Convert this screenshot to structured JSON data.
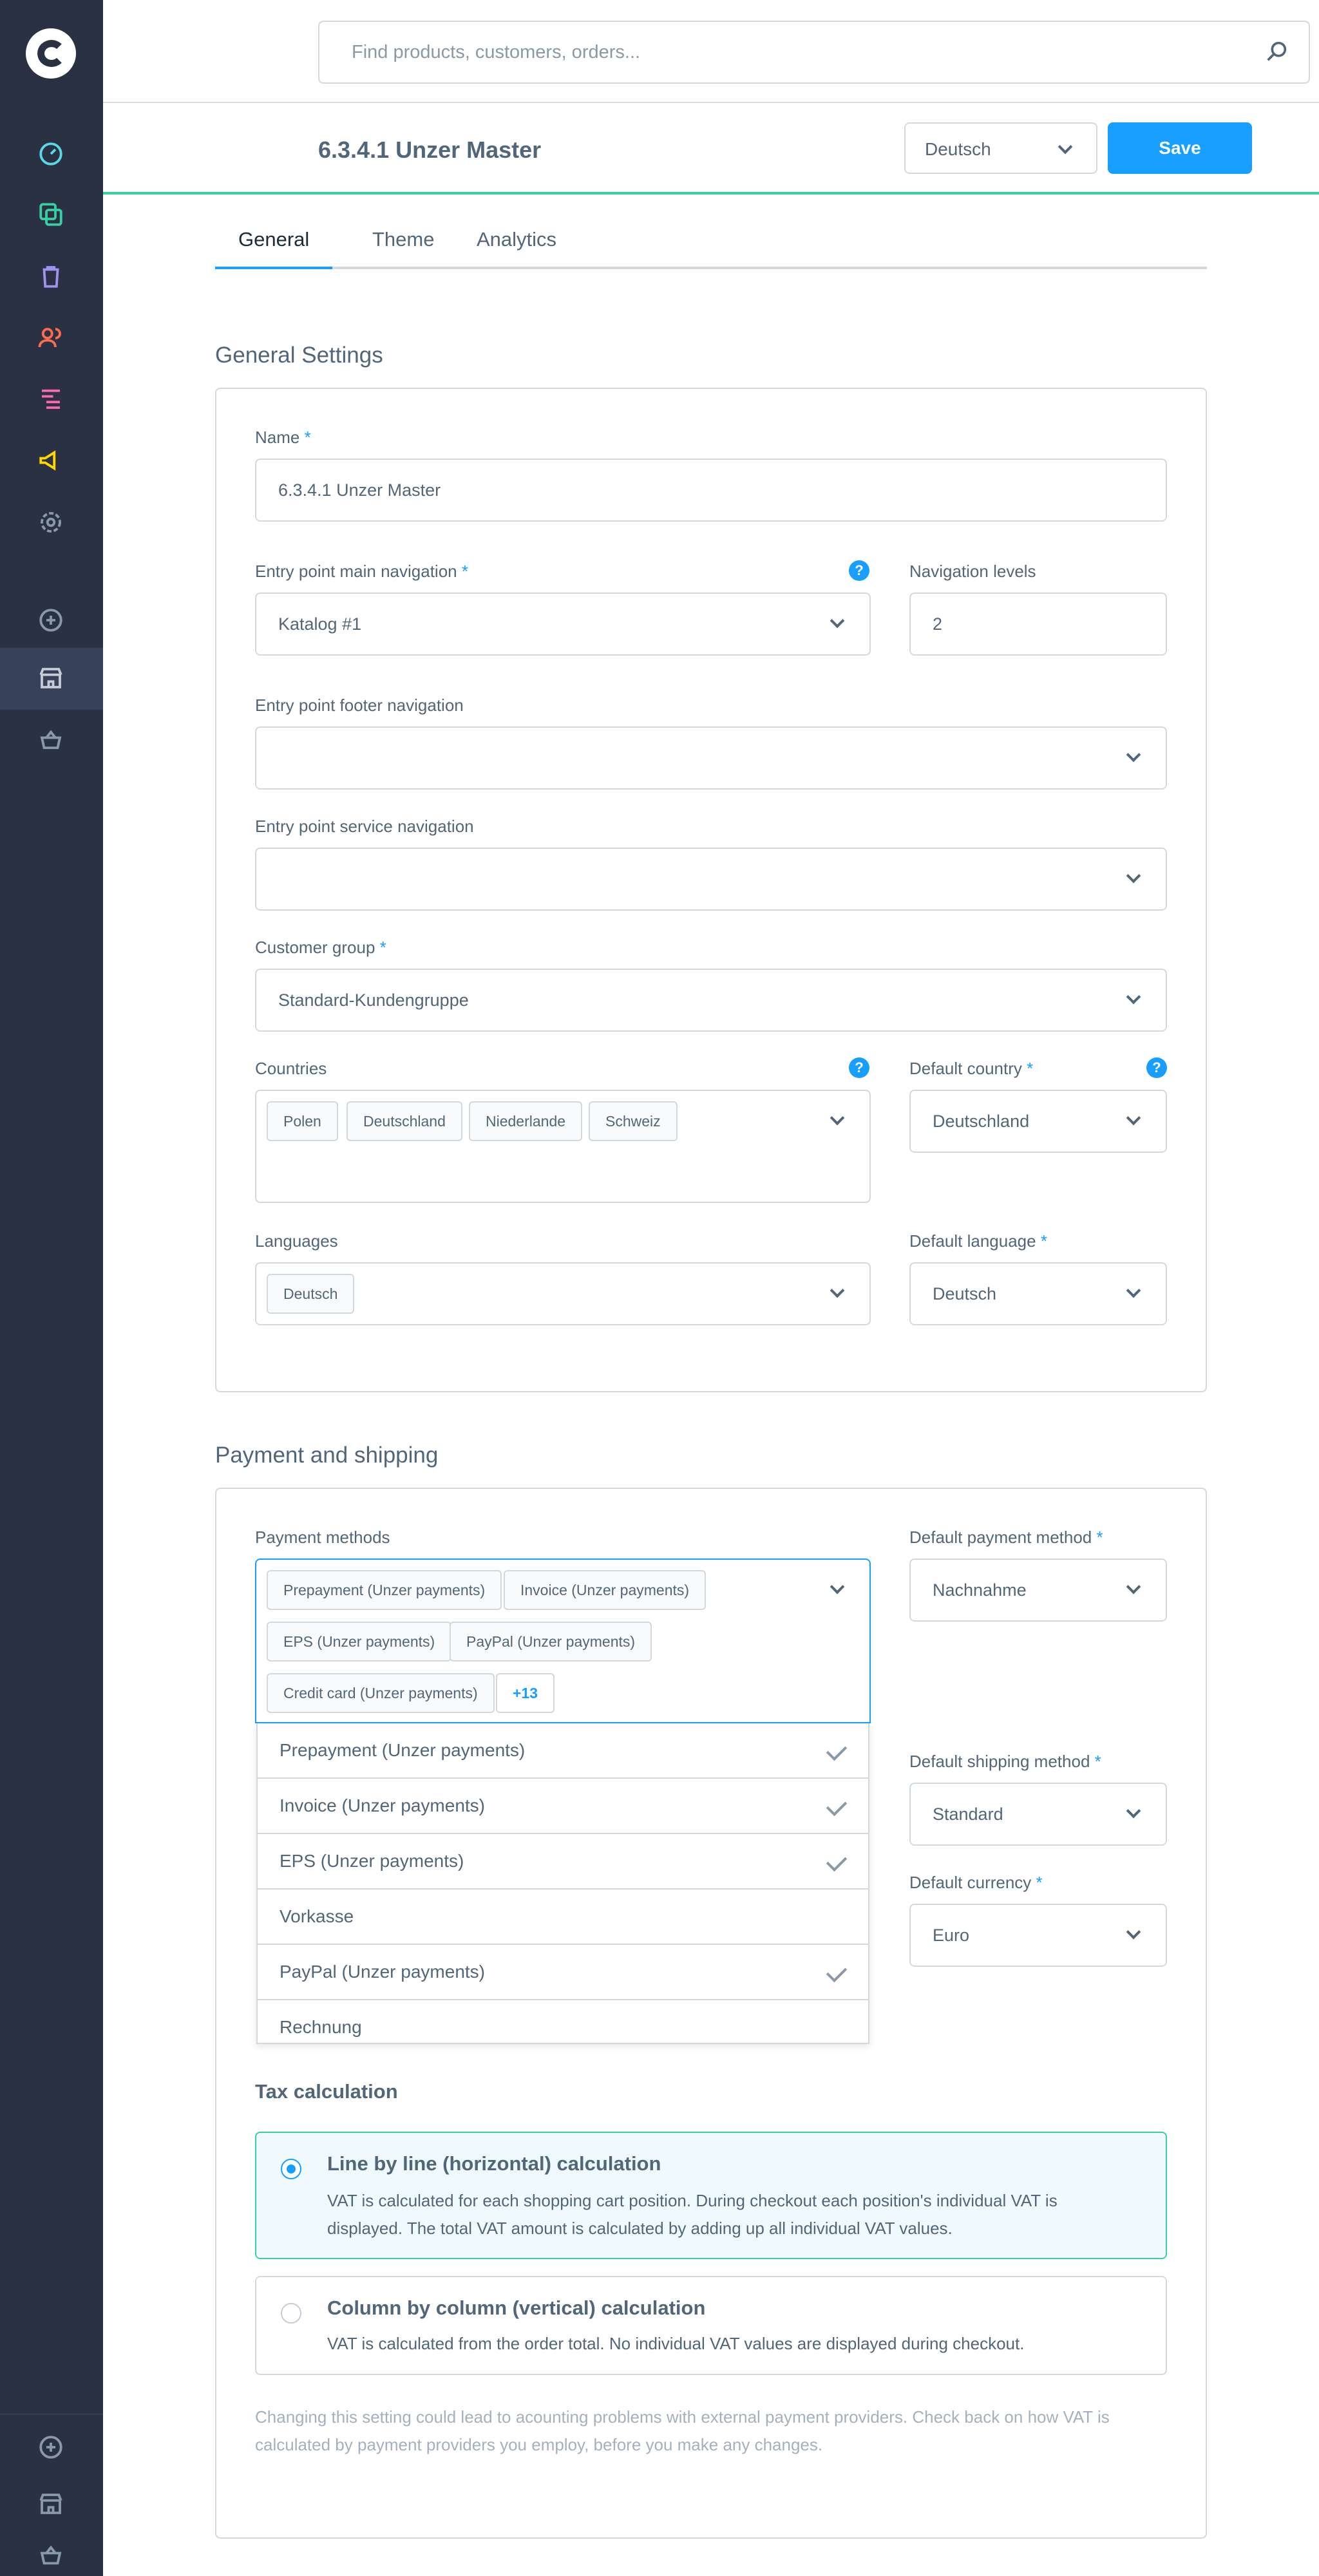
{
  "search": {
    "placeholder": "Find products, customers, orders..."
  },
  "header": {
    "title": "6.3.4.1 Unzer Master",
    "language": "Deutsch",
    "save_label": "Save"
  },
  "tabs": [
    "General",
    "Theme",
    "Analytics"
  ],
  "general": {
    "section_title": "General Settings",
    "name_label": "Name",
    "name_value": "6.3.4.1 Unzer Master",
    "entry_main_label": "Entry point main navigation",
    "entry_main_value": "Katalog #1",
    "nav_levels_label": "Navigation levels",
    "nav_levels_value": "2",
    "footer_nav_label": "Entry point footer navigation",
    "service_nav_label": "Entry point service navigation",
    "customer_group_label": "Customer group",
    "customer_group_value": "Standard-Kundengruppe",
    "countries_label": "Countries",
    "countries": [
      "Polen",
      "Deutschland",
      "Niederlande",
      "Schweiz"
    ],
    "default_country_label": "Default country",
    "default_country_value": "Deutschland",
    "languages_label": "Languages",
    "languages": [
      "Deutsch"
    ],
    "default_language_label": "Default language",
    "default_language_value": "Deutsch",
    "help": "?",
    "req": "*"
  },
  "payment": {
    "section_title": "Payment and shipping",
    "payment_methods_label": "Payment methods",
    "chips": [
      "Prepayment (Unzer payments)",
      "Invoice (Unzer payments)",
      "EPS (Unzer payments)",
      "PayPal (Unzer payments)",
      "Credit card (Unzer payments)"
    ],
    "more": "+13",
    "default_payment_label": "Default payment method",
    "default_payment_value": "Nachnahme",
    "default_shipping_label": "Default shipping method",
    "default_shipping_value": "Standard",
    "default_currency_label": "Default currency",
    "default_currency_value": "Euro",
    "dropdown": [
      {
        "label": "Prepayment (Unzer payments)",
        "checked": true
      },
      {
        "label": "Invoice (Unzer payments)",
        "checked": true
      },
      {
        "label": "EPS (Unzer payments)",
        "checked": true
      },
      {
        "label": "Vorkasse",
        "checked": false
      },
      {
        "label": "PayPal (Unzer payments)",
        "checked": true
      },
      {
        "label": "Rechnung",
        "checked": false
      }
    ]
  },
  "tax": {
    "heading": "Tax calculation",
    "option1_title": "Line by line (horizontal) calculation",
    "option1_text": "VAT is calculated for each shopping cart position. During checkout each position's individual VAT is displayed. The total VAT amount is calculated by adding up all individual VAT values.",
    "option2_title": "Column by column (vertical) calculation",
    "option2_text": "VAT is calculated from the order total. No individual VAT values are displayed during checkout.",
    "hint": "Changing this setting could lead to acounting problems with external payment providers. Check back on how VAT is calculated by payment providers you employ, before you make any changes."
  }
}
